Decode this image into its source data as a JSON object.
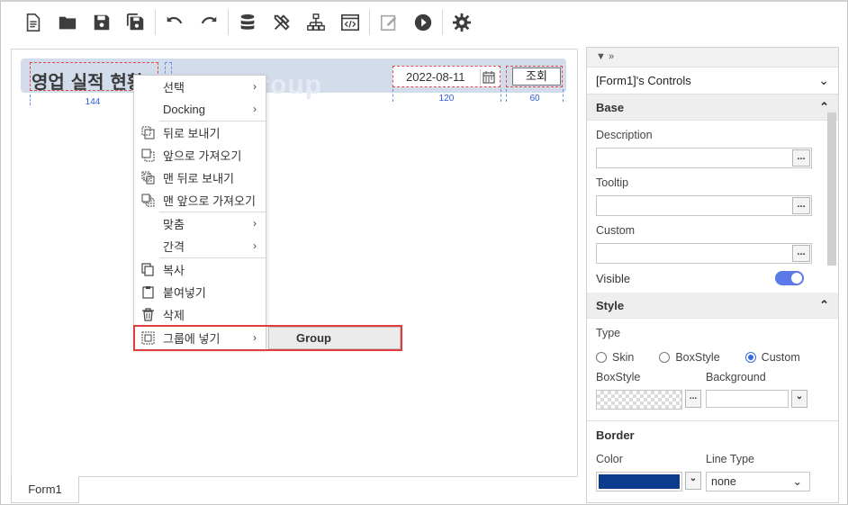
{
  "toolbar": {
    "items": [
      "new-file-icon",
      "open-folder-icon",
      "save-icon",
      "save-all-icon",
      "undo-icon",
      "redo-icon",
      "database-icon",
      "tools-icon",
      "hierarchy-icon",
      "code-view-icon",
      "edit-icon",
      "run-icon",
      "settings-icon"
    ]
  },
  "canvas": {
    "title": "영업 실적 현황",
    "watermark": "Group",
    "dims": {
      "title_width": "144",
      "date_width": "120",
      "button_width": "60"
    },
    "date_value": "2022-08-11",
    "query_button": "조회"
  },
  "context_menu": {
    "items": [
      {
        "label": "선택",
        "submenu": true
      },
      {
        "label": "Docking",
        "submenu": true
      },
      {
        "label": "뒤로 보내기"
      },
      {
        "label": "앞으로 가져오기"
      },
      {
        "label": "맨 뒤로 보내기"
      },
      {
        "label": "맨 앞으로 가져오기"
      },
      {
        "label": "맞춤",
        "submenu": true
      },
      {
        "label": "간격",
        "submenu": true
      },
      {
        "label": "복사"
      },
      {
        "label": "붙여넣기"
      },
      {
        "label": "삭제"
      },
      {
        "label": "그룹에 넣기",
        "submenu": true
      }
    ],
    "submenu_item": "Group"
  },
  "tabs": {
    "active": "Form1"
  },
  "panel": {
    "title": "[Form1]'s Controls",
    "sections": {
      "base": "Base",
      "style": "Style",
      "border": "Border"
    },
    "fields": {
      "description": "Description",
      "tooltip": "Tooltip",
      "custom": "Custom",
      "visible": "Visible",
      "type": "Type",
      "boxstyle": "BoxStyle",
      "background": "Background",
      "color": "Color",
      "line_type": "Line Type",
      "line_type_value": "none"
    },
    "type_options": [
      "Skin",
      "BoxStyle",
      "Custom"
    ],
    "type_selected": "Custom",
    "border_color": "#0c3a8c",
    "visible_on": true
  }
}
